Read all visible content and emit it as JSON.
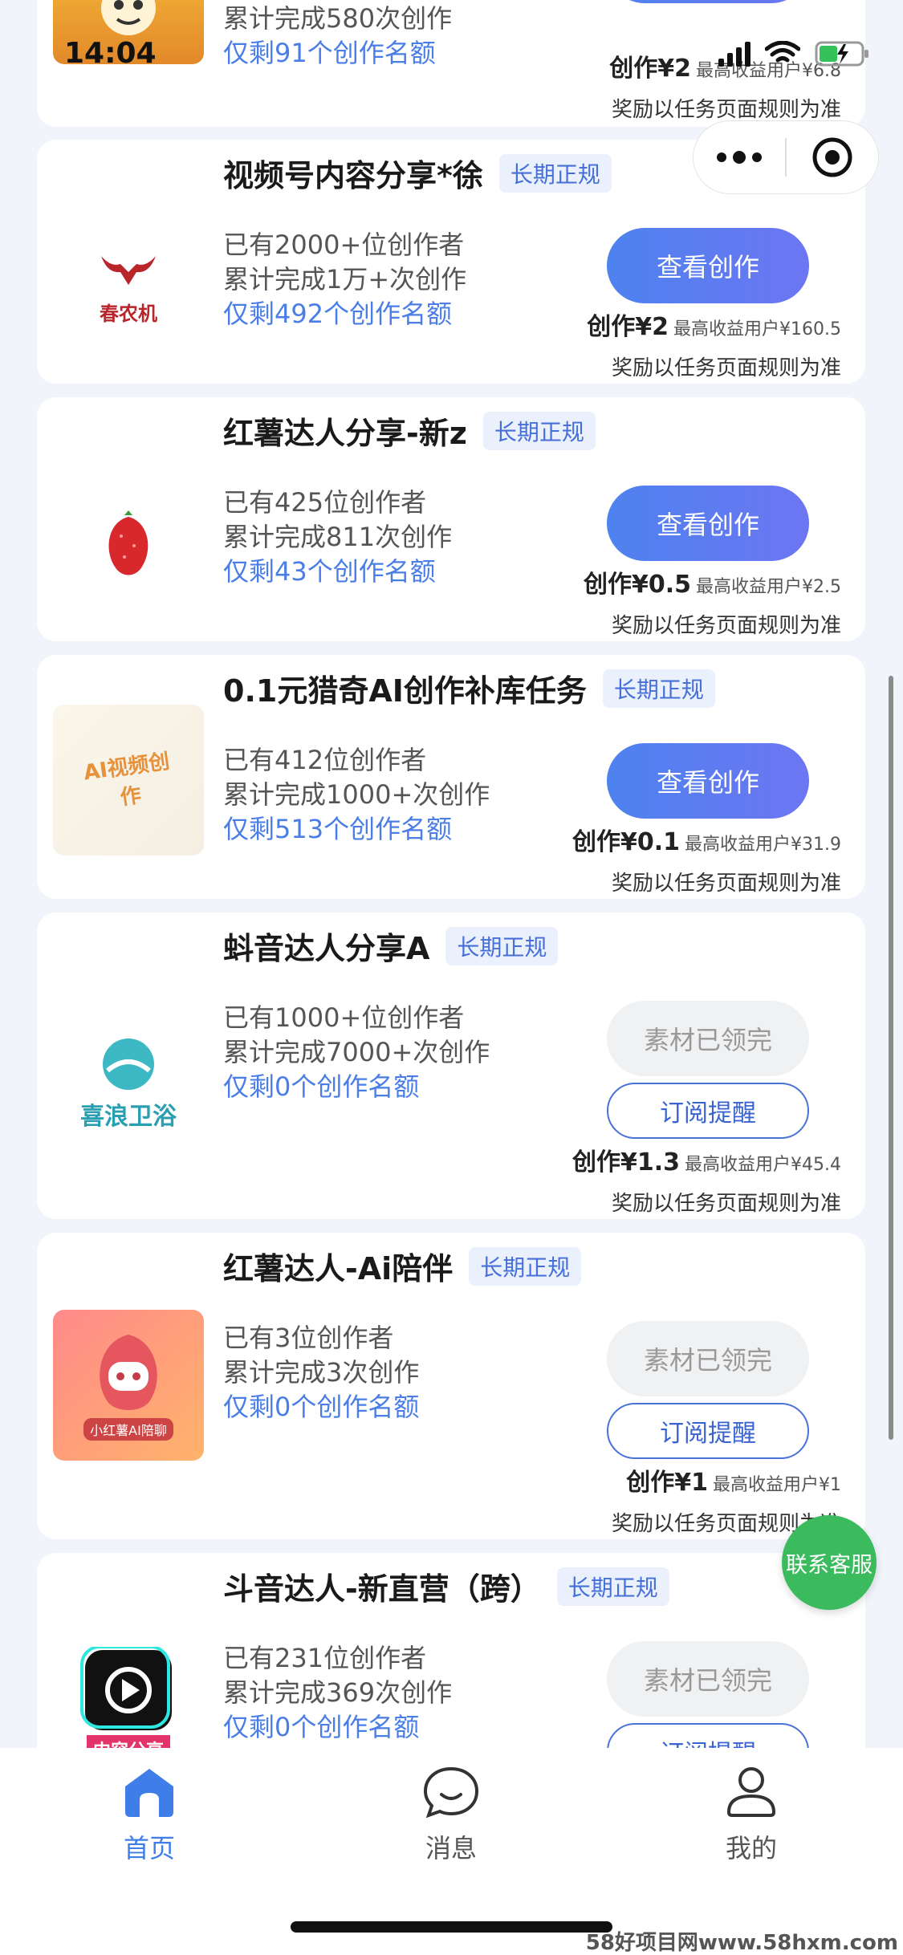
{
  "status_bar": {
    "time": "14:04"
  },
  "common": {
    "tag": "长期正规",
    "reward_note": "奖励以任务页面规则为准",
    "btn_view": "查看创作",
    "btn_done": "素材已领完",
    "btn_sub": "订阅提醒",
    "max_label": "最高收益用户"
  },
  "cards": [
    {
      "title": "",
      "creators": "",
      "completed": "累计完成580次创作",
      "remaining": "仅剩91个创作名额",
      "reward": "创作¥2",
      "max": "¥6.8"
    },
    {
      "title": "视频号内容分享*徐",
      "creators": "已有2000+位创作者",
      "completed": "累计完成1万+次创作",
      "remaining": "仅剩492个创作名额",
      "reward": "创作¥2",
      "max": "¥160.5",
      "logo_text": "春农机"
    },
    {
      "title": "红薯达人分享-新z",
      "creators": "已有425位创作者",
      "completed": "累计完成811次创作",
      "remaining": "仅剩43个创作名额",
      "reward": "创作¥0.5",
      "max": "¥2.5"
    },
    {
      "title": "0.1元猎奇AI创作补库任务",
      "creators": "已有412位创作者",
      "completed": "累计完成1000+次创作",
      "remaining": "仅剩513个创作名额",
      "reward": "创作¥0.1",
      "max": "¥31.9",
      "logo_text": "AI视频创作"
    },
    {
      "title": "蚪音达人分享A",
      "creators": "已有1000+位创作者",
      "completed": "累计完成7000+次创作",
      "remaining": "仅剩0个创作名额",
      "reward": "创作¥1.3",
      "max": "¥45.4",
      "logo_text": "喜浪卫浴"
    },
    {
      "title": "红薯达人-Ai陪伴",
      "creators": "已有3位创作者",
      "completed": "累计完成3次创作",
      "remaining": "仅剩0个创作名额",
      "reward": "创作¥1",
      "max": "¥1",
      "logo_text": "小红薯AI陪聊"
    },
    {
      "title": "斗音达人-新直营（跨）",
      "creators": "已有231位创作者",
      "completed": "累计完成369次创作",
      "remaining": "仅剩0个创作名额",
      "logo_text": "内容分享"
    }
  ],
  "contact": "联系客服",
  "tabs": {
    "home": "首页",
    "messages": "消息",
    "mine": "我的"
  },
  "watermark": "58好项目网www.58hxm.com",
  "colors": {
    "accent": "#4d82ef",
    "link": "#4a7ee6",
    "green": "#3cbb5e"
  }
}
